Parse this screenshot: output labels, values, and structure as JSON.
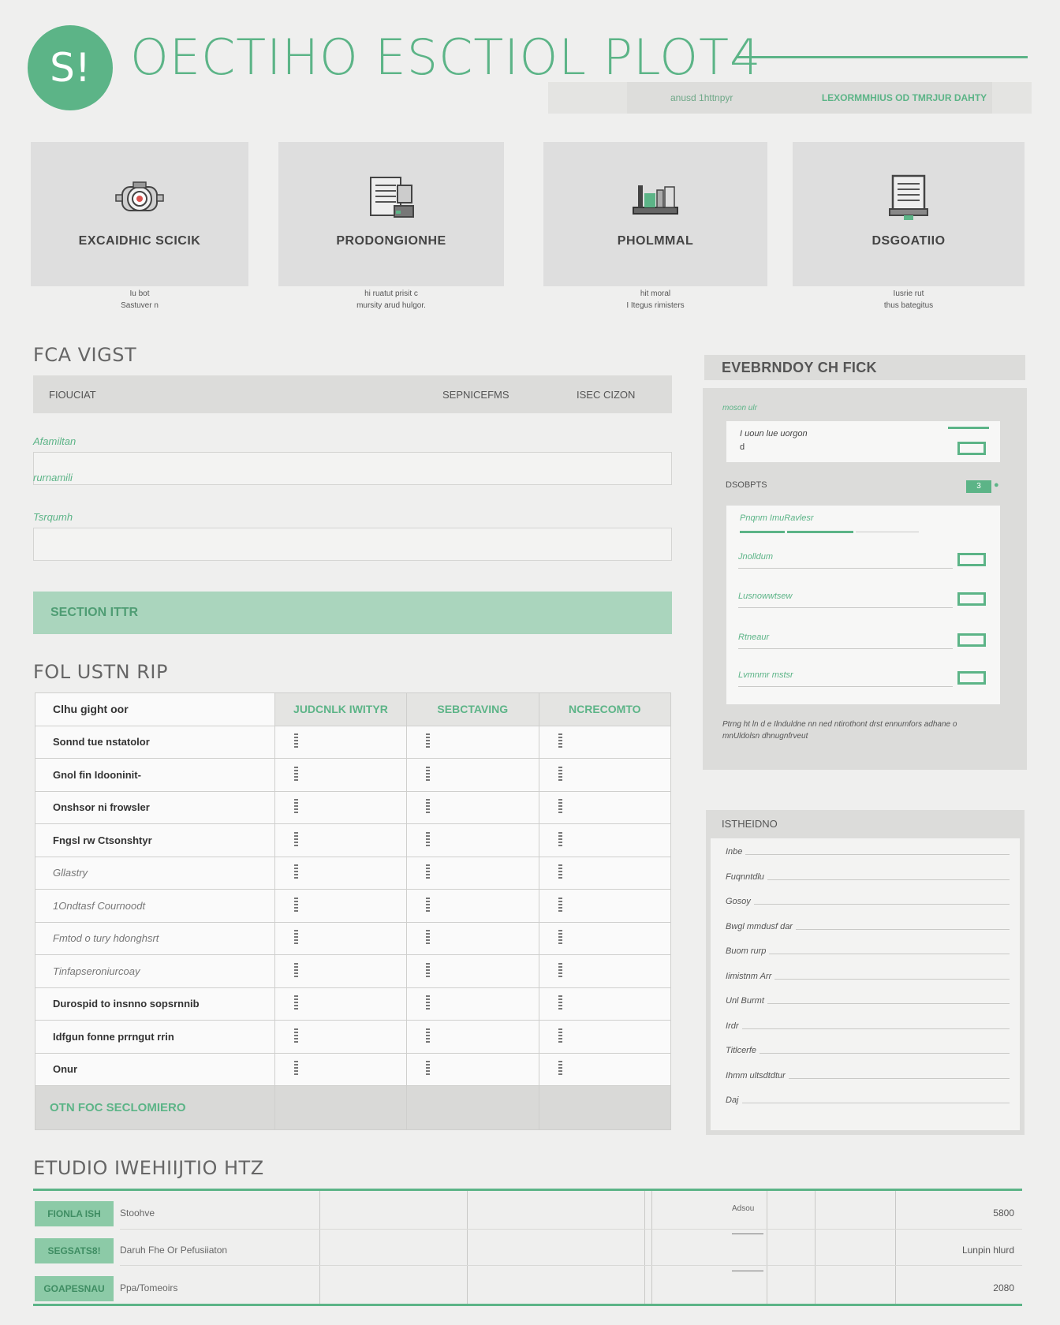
{
  "header": {
    "logo_text": "S!",
    "title": "OECTIHO ESCTIOL PLOT4",
    "meta_left": "anusd 1httnpyr",
    "meta_right": "LEXORMMHIUS OD TMRJUR DAHTY"
  },
  "cards": [
    {
      "label": "EXCAIDHIC SCICIK",
      "icon": "camera-lens-icon",
      "desc_line1": "Iu bot",
      "desc_line2": "Sastuver n"
    },
    {
      "label": "PRODONGIONHE",
      "icon": "document-server-icon",
      "desc_line1": "hi ruatut prisit c",
      "desc_line2": "mursity arud hulgor."
    },
    {
      "label": "PHOLMMAL",
      "icon": "chart-monitor-icon",
      "desc_line1": "hit moral",
      "desc_line2": "I Itegus rimisters"
    },
    {
      "label": "DSGOATIIO",
      "icon": "printer-notepad-icon",
      "desc_line1": "Iusrie rut",
      "desc_line2": "thus bategitus"
    }
  ],
  "focus_section": {
    "heading": "FCA VIGST",
    "columns": [
      "FIOUCIAT",
      "SEPNICEFMS",
      "ISEC CIZON"
    ],
    "fields": [
      "Afamiltan",
      "rurnamili",
      "Tsrqumh"
    ]
  },
  "banner": {
    "label": "SECTION ITTR"
  },
  "list_section": {
    "heading": "FOL USTN RIP",
    "columns": [
      "Clhu gight oor",
      "JUDCNLK IWITYR",
      "SEBCTAVING",
      "NCRECOMTO"
    ],
    "rows": [
      {
        "label": "Sonnd tue nstatolor",
        "style": "bold"
      },
      {
        "label": "Gnol fin Idooninit-",
        "style": "bold"
      },
      {
        "label": "Onshsor ni frowsler",
        "style": "bold"
      },
      {
        "label": "Fngsl rw Ctsonshtyr",
        "style": "bold"
      },
      {
        "label": "Gllastry",
        "style": "light"
      },
      {
        "label": "1Ondtasf Cournoodt",
        "style": "light"
      },
      {
        "label": "Fmtod o tury hdonghsrt",
        "style": "light"
      },
      {
        "label": "Tinfapseroniurcoay",
        "style": "light"
      },
      {
        "label": "Durospid to insnno sopsrnnib",
        "style": "bold"
      },
      {
        "label": "Idfgun fonne prrngut rrin",
        "style": "bold"
      },
      {
        "label": "Onur",
        "style": "bold"
      }
    ],
    "footer_label": "OTN FOC SECLOMIERO"
  },
  "right_panel": {
    "heading": "EVEBRNDOY CH FICK",
    "small_label": "moson ulr",
    "top_item_line1": "I uoun lue uorgon",
    "top_item_line2": "d",
    "section_label": "DSOBPTS",
    "toggle_label": "3",
    "sub_heading": "Pnqnm ImuRavlesr",
    "check_items": [
      "Jnolldum",
      "Lusnowwtsew",
      "Rtneaur",
      "Lvmnmr mstsr"
    ],
    "footnote": "Ptrng ht ln d e Ilnduldne nn ned ntirothont drst ennumfors adhane o mnUldolsn dhnugnfrveut"
  },
  "meta_panel": {
    "heading": "ISTHEIDNO",
    "rows": [
      "Inbe",
      "Fuqnntdlu",
      "Gosoy",
      "Bwgl mmdusf dar",
      "Buom rurp",
      "Iimistnm Arr",
      "Unl Burmt",
      "Irdr",
      "Titlcerfe",
      "Ihmm ultsdtdtur",
      "Daj"
    ]
  },
  "bottom_section": {
    "heading": "ETUDIO IWEHIIJTIO HTZ",
    "rows": [
      {
        "tag": "FIONLA ISH",
        "desc": "Stoohve",
        "mid": "Adsou",
        "value": "5800"
      },
      {
        "tag": "SEGSATS8!",
        "desc": "Daruh Fhe Or Pefusiiaton",
        "mid": "",
        "value": "Lunpin hlurd"
      },
      {
        "tag": "GOAPESNAU",
        "desc": "Ppa/Tomeoirs",
        "mid": "",
        "value": "2080"
      }
    ]
  },
  "colors": {
    "accent": "#5cb487",
    "banner": "#aad5bd",
    "panel": "#dcdcda",
    "background": "#efefee"
  }
}
